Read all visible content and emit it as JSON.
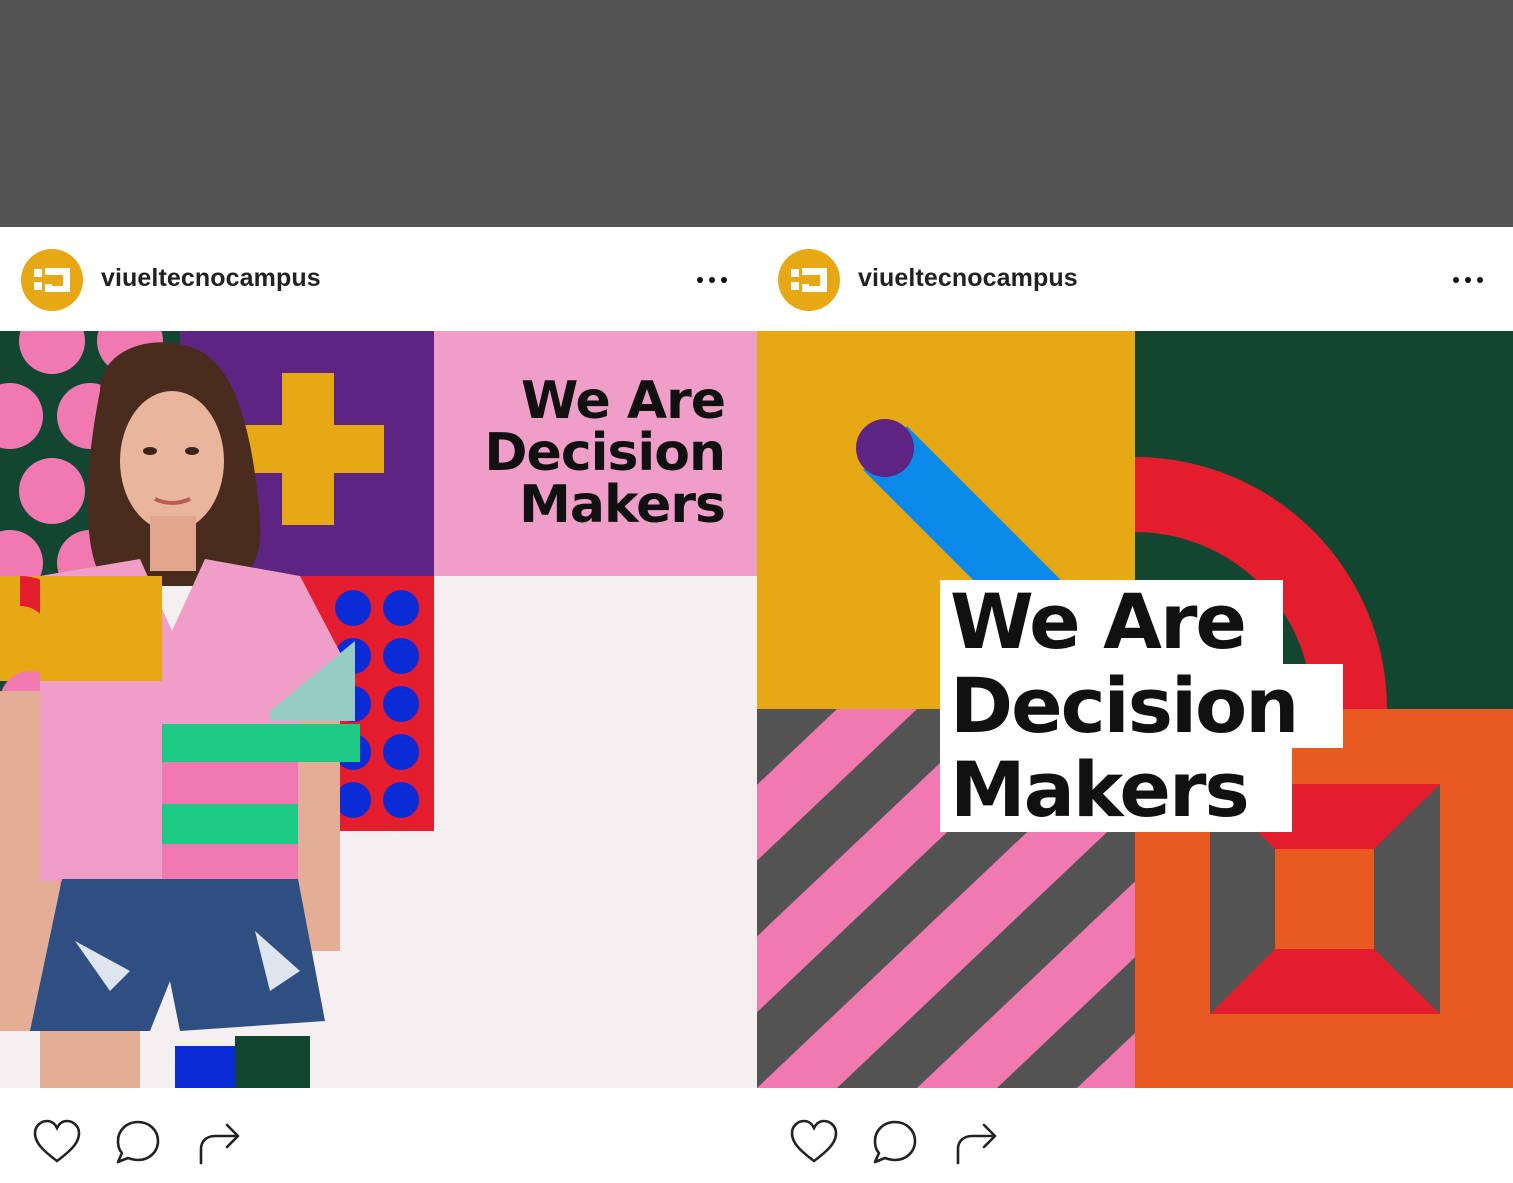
{
  "posts": [
    {
      "username": "viueltecnocampus",
      "headline": [
        "We Are",
        "Decision",
        "Makers"
      ],
      "icons": {
        "avatar": "brand-logo",
        "more": "more-dots-icon",
        "like": "heart-icon",
        "comment": "comment-icon",
        "share": "share-arrow-icon"
      }
    },
    {
      "username": "viueltecnocampus",
      "headline": [
        "We Are",
        "Decision",
        "Makers"
      ],
      "icons": {
        "avatar": "brand-logo",
        "more": "more-dots-icon",
        "like": "heart-icon",
        "comment": "comment-icon",
        "share": "share-arrow-icon"
      }
    }
  ],
  "colors": {
    "brand_yellow": "#e7a815",
    "purple": "#5d2481",
    "pink": "#f07ab0",
    "light_pink": "#ef9fc7",
    "dark_green": "#124631",
    "red": "#e31c2e",
    "blue": "#0a2bd6",
    "sky_blue": "#0b89e8",
    "orange": "#e85a20",
    "grey": "#535353",
    "mint": "#1cc985"
  }
}
